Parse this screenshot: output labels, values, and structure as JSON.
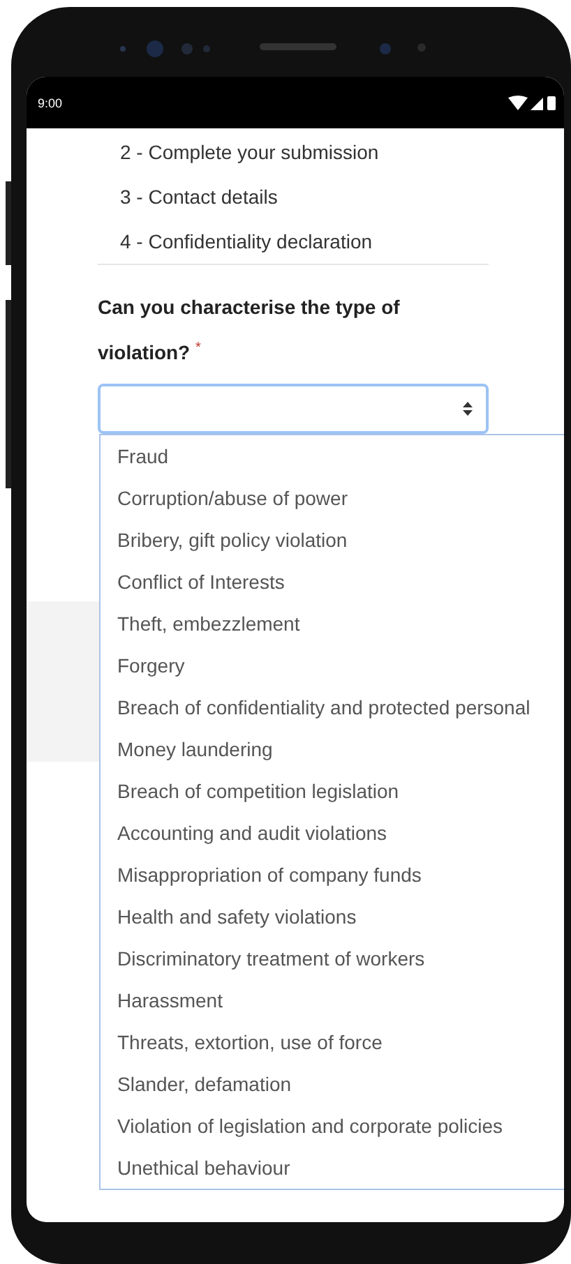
{
  "status_bar": {
    "time": "9:00"
  },
  "steps": [
    "2 - Complete your submission",
    "3 - Contact details",
    "4 - Confidentiality declaration"
  ],
  "question": {
    "label": "Can you characterise the type of violation? $^{*}$"
  },
  "select": {
    "expanded": true,
    "options": [
      {
        "label": "Fraud",
        "selected": false
      },
      {
        "label": "Corruption/abuse of power",
        "selected": false
      },
      {
        "label": "Bribery, gift policy violation",
        "selected": false
      },
      {
        "label": "Conflict of Interests",
        "selected": false
      },
      {
        "label": "Theft, embezzlement",
        "selected": false
      },
      {
        "label": "Forgery",
        "selected": false
      },
      {
        "label": "Breach of confidentiality and protected personal",
        "selected": false
      },
      {
        "label": "Money laundering",
        "selected": false
      },
      {
        "label": "Breach of competition legislation",
        "selected": false
      },
      {
        "label": "Accounting and audit violations",
        "selected": false
      },
      {
        "label": "Misappropriation of company funds",
        "selected": false
      },
      {
        "label": "Health and safety violations",
        "selected": false
      },
      {
        "label": "Discriminatory treatment of workers",
        "selected": false
      },
      {
        "label": "Harassment",
        "selected": false
      },
      {
        "label": "Threats, extortion, use of force",
        "selected": false
      },
      {
        "label": "Slander, defamation",
        "selected": false
      },
      {
        "label": "Violation of legislation and corporate policies",
        "selected": false
      },
      {
        "label": "Unethical behaviour",
        "selected": false
      }
    ]
  }
}
